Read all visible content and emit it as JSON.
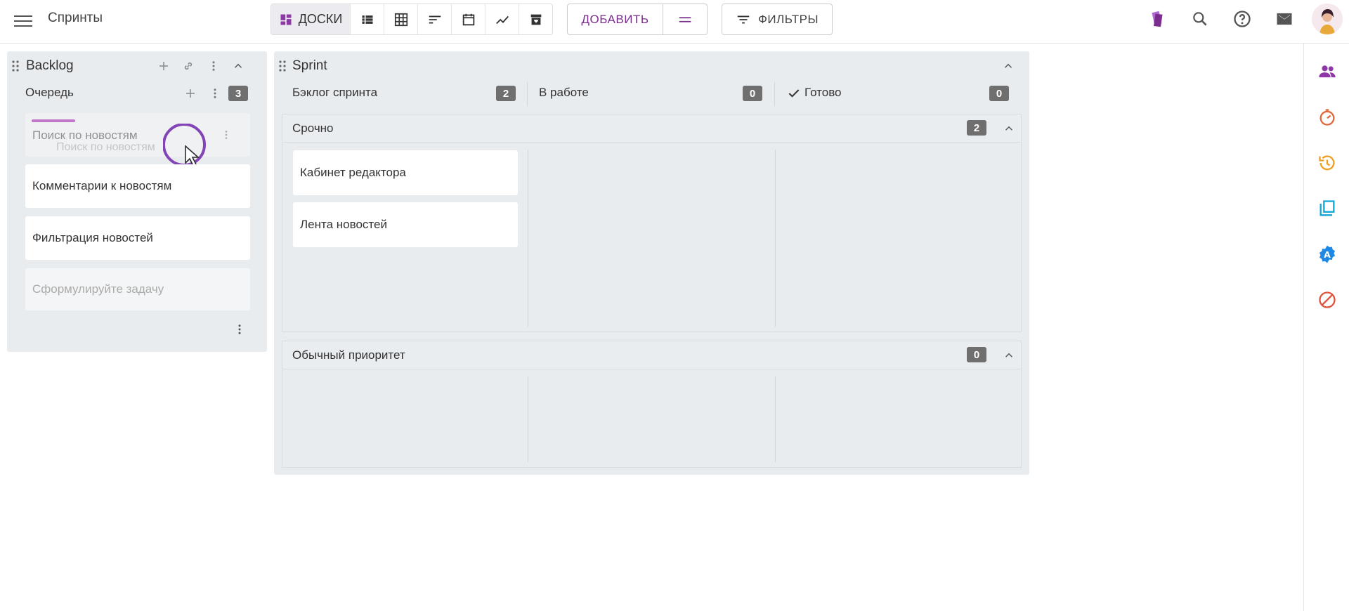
{
  "header": {
    "title": "Спринты",
    "boards_label": "ДОСКИ",
    "add_label": "ДОБАВИТЬ",
    "filters_label": "ФИЛЬТРЫ"
  },
  "colors": {
    "accent": "#7b2d8e",
    "badge": "#6f6f6f",
    "panel": "#e9ecef"
  },
  "backlog": {
    "title": "Backlog",
    "queue": {
      "title": "Очередь",
      "count": "3"
    },
    "cards": [
      {
        "title": "Поиск по новостям",
        "ghost": "Поиск по новостям"
      },
      {
        "title": "Комментарии к новостям"
      },
      {
        "title": "Фильтрация новостей"
      }
    ],
    "new_card_placeholder": "Сформулируйте задачу"
  },
  "sprint": {
    "title": "Sprint",
    "columns": [
      {
        "title": "Бэклог спринта",
        "count": "2"
      },
      {
        "title": "В работе",
        "count": "0"
      },
      {
        "title": "Готово",
        "count": "0"
      }
    ],
    "sections": [
      {
        "title": "Срочно",
        "count": "2",
        "cards": [
          "Кабинет редактора",
          "Лента новостей"
        ]
      },
      {
        "title": "Обычный приоритет",
        "count": "0"
      }
    ]
  }
}
